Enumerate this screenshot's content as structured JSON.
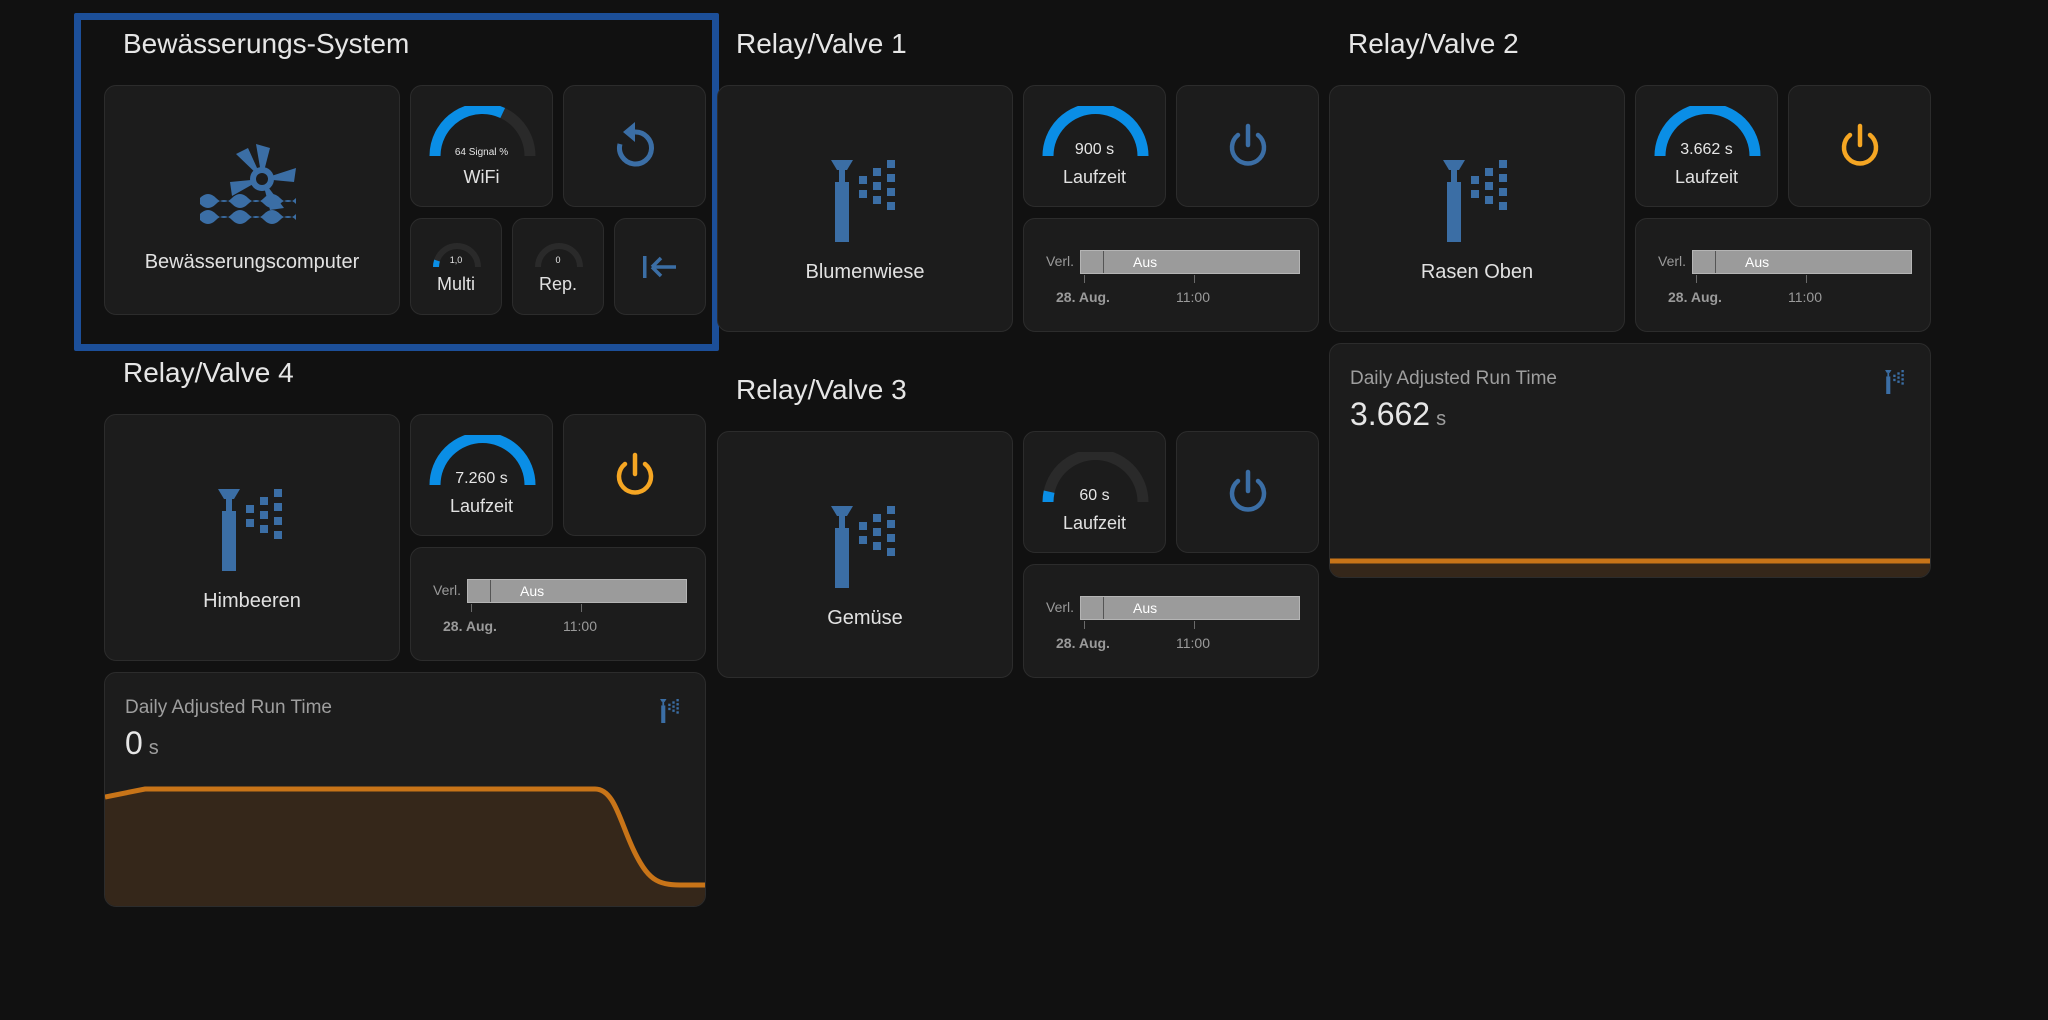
{
  "colors": {
    "background": "#111111",
    "card": "#1c1c1c",
    "highlight_border": "#1c4f99",
    "icon_blue": "#3b6ea5",
    "gauge_blue": "#0a8ee6",
    "power_on": "#f5a623",
    "graph_line": "#c87418",
    "graph_fill": "#35271a"
  },
  "system": {
    "title": "Bewässerungs-System",
    "main_icon": "water-pump-icon",
    "main_label": "Bewässerungscomputer",
    "wifi": {
      "value_text": "64 Signal %",
      "value": 64,
      "max": 100,
      "label": "WiFi"
    },
    "restart_icon": "restart-icon",
    "multi": {
      "value_text": "1,0",
      "value": 1,
      "max": 10,
      "label": "Multi"
    },
    "rep": {
      "value_text": "0",
      "value": 0,
      "max": 10,
      "label": "Rep."
    },
    "collapse_icon": "arrow-collapse-left-icon"
  },
  "valves": [
    {
      "title": "Relay/Valve 1",
      "icon": "sprinkler-icon",
      "label": "Blumenwiese",
      "runtime": {
        "value_text": "900 s",
        "fraction": 1.0,
        "label": "Laufzeit"
      },
      "power_icon": "power-icon",
      "power_state": "off",
      "history": {
        "row_label": "Verl.",
        "state": "Aus",
        "date": "28. Aug.",
        "time": "11:00"
      }
    },
    {
      "title": "Relay/Valve 2",
      "icon": "sprinkler-icon",
      "label": "Rasen Oben",
      "runtime": {
        "value_text": "3.662 s",
        "fraction": 1.0,
        "label": "Laufzeit"
      },
      "power_icon": "power-icon",
      "power_state": "on",
      "history": {
        "row_label": "Verl.",
        "state": "Aus",
        "date": "28. Aug.",
        "time": "11:00"
      }
    },
    {
      "title": "Relay/Valve 3",
      "icon": "sprinkler-icon",
      "label": "Gemüse",
      "runtime": {
        "value_text": "60 s",
        "fraction": 0.07,
        "label": "Laufzeit"
      },
      "power_icon": "power-icon",
      "power_state": "off",
      "history": {
        "row_label": "Verl.",
        "state": "Aus",
        "date": "28. Aug.",
        "time": "11:00"
      }
    },
    {
      "title": "Relay/Valve 4",
      "icon": "sprinkler-icon",
      "label": "Himbeeren",
      "runtime": {
        "value_text": "7.260 s",
        "fraction": 1.0,
        "label": "Laufzeit"
      },
      "power_icon": "power-icon",
      "power_state": "on",
      "history": {
        "row_label": "Verl.",
        "state": "Aus",
        "date": "28. Aug.",
        "time": "11:00"
      }
    }
  ],
  "sensors": {
    "valve2": {
      "title": "Daily Adjusted Run Time",
      "value": "3.662",
      "unit": "s",
      "icon": "sprinkler-small-icon"
    },
    "valve4": {
      "title": "Daily Adjusted Run Time",
      "value": "0",
      "unit": "s",
      "icon": "sprinkler-small-icon"
    }
  }
}
